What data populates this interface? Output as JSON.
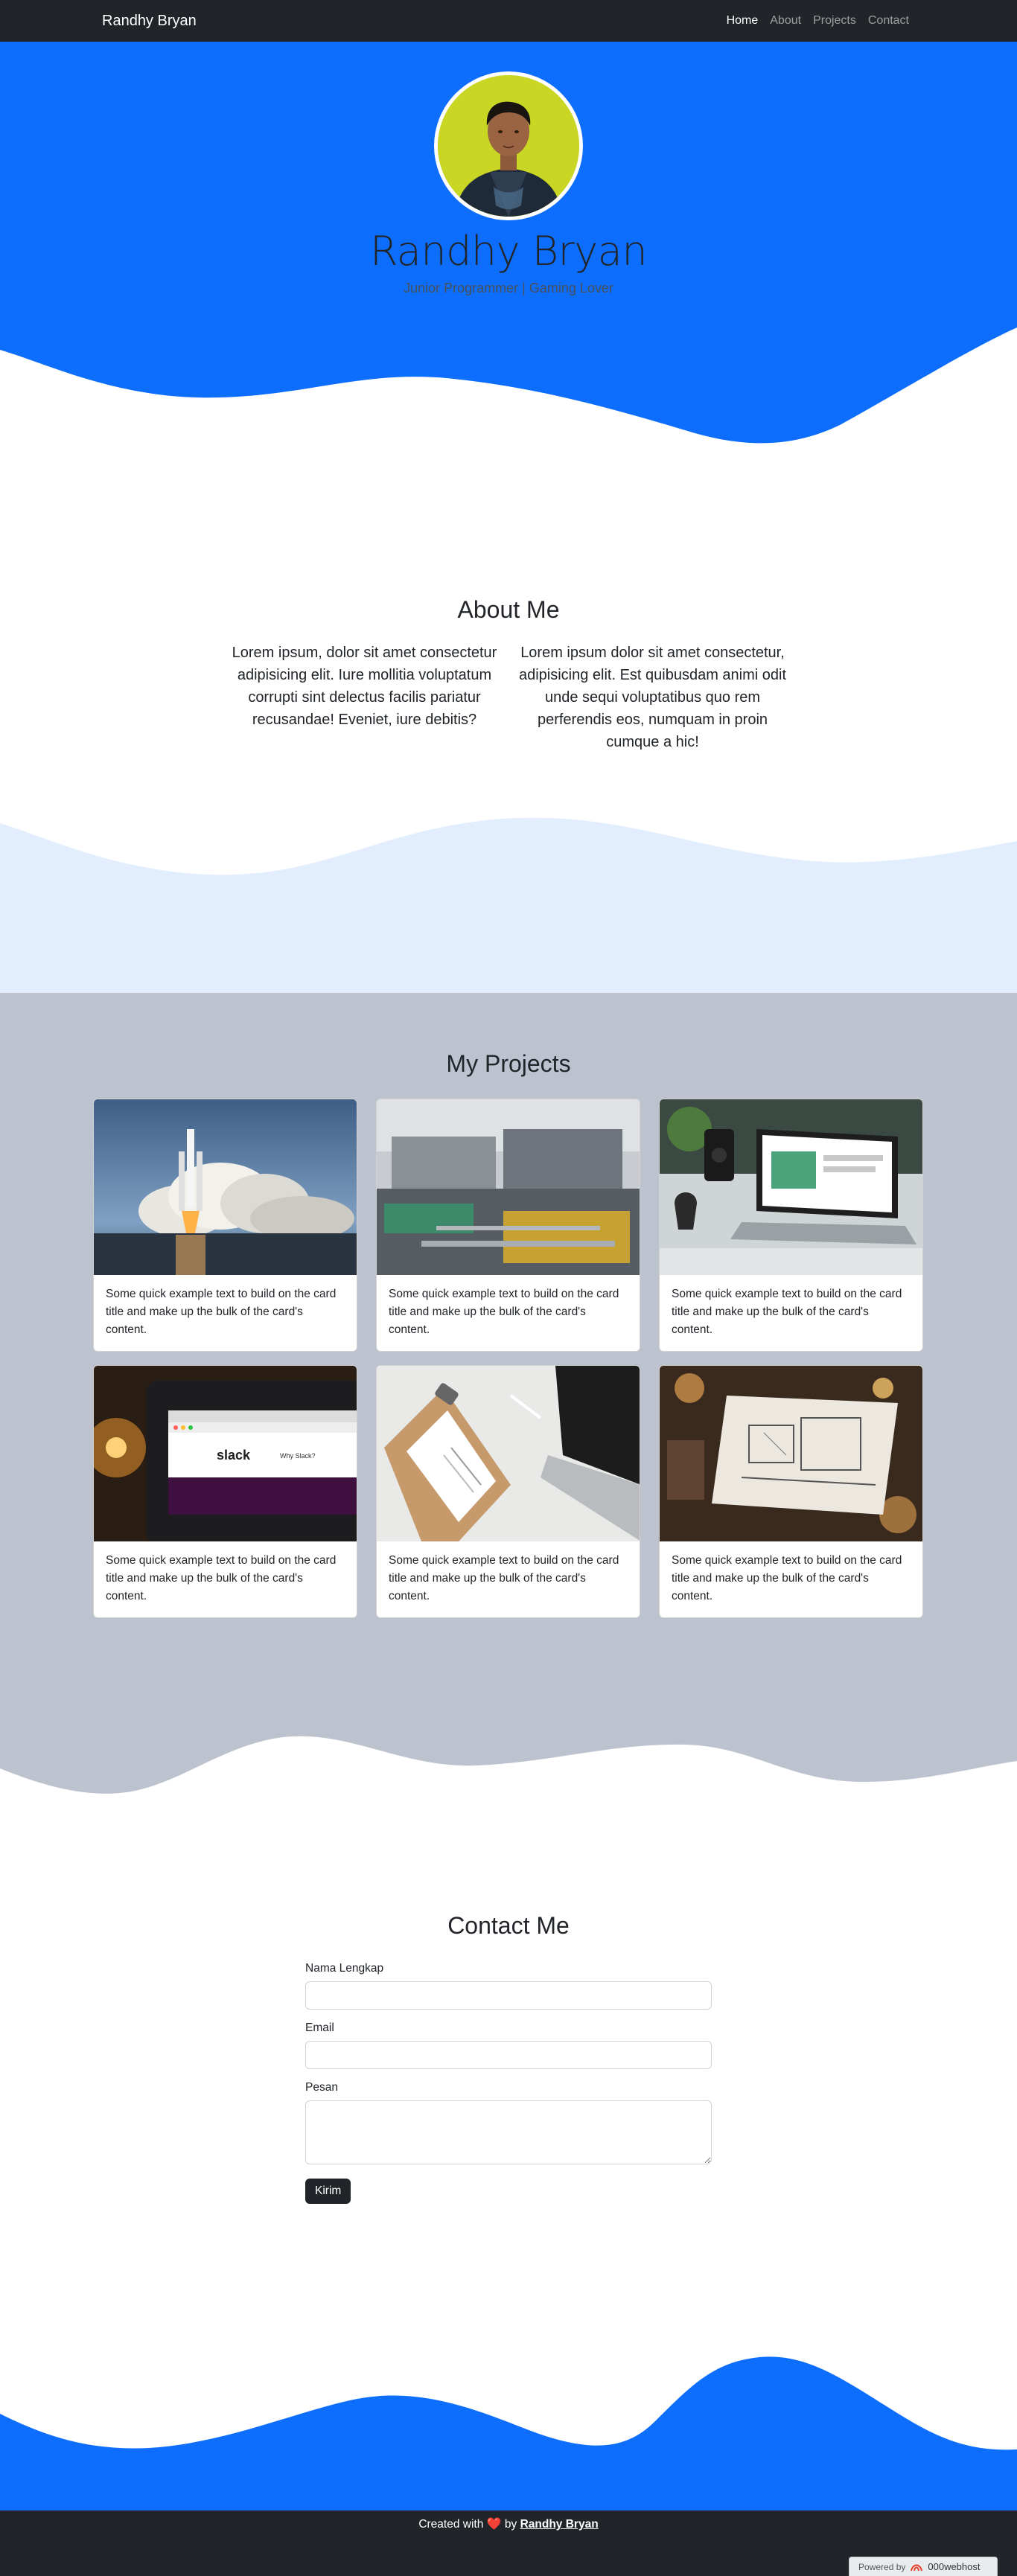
{
  "navbar": {
    "brand": "Randhy Bryan",
    "links": [
      {
        "label": "Home",
        "active": true
      },
      {
        "label": "About",
        "active": false
      },
      {
        "label": "Projects",
        "active": false
      },
      {
        "label": "Contact",
        "active": false
      }
    ]
  },
  "hero": {
    "name": "Randhy Bryan",
    "tagline": "Junior Programmer | Gaming Lover"
  },
  "about": {
    "title": "About Me",
    "col1": "Lorem ipsum, dolor sit amet consectetur adipisicing elit. Iure mollitia voluptatum corrupti sint delectus facilis pariatur recusandae! Eveniet, iure debitis?",
    "col2": "Lorem ipsum dolor sit amet consectetur, adipisicing elit. Est quibusdam animi odit unde sequi voluptatibus quo rem perferendis eos, numquam in proin cumque a hic!"
  },
  "projects": {
    "title": "My Projects",
    "cards": [
      {
        "image": "rocket-launch",
        "text": "Some quick example text to build on the card title and make up the bulk of the card's content."
      },
      {
        "image": "industrial-site",
        "text": "Some quick example text to build on the card title and make up the bulk of the card's content."
      },
      {
        "image": "laptop-desk",
        "text": "Some quick example text to build on the card title and make up the bulk of the card's content."
      },
      {
        "image": "slack-browser",
        "text": "Some quick example text to build on the card title and make up the bulk of the card's content."
      },
      {
        "image": "clipboard-laptop",
        "text": "Some quick example text to build on the card title and make up the bulk of the card's content."
      },
      {
        "image": "blueprint-sketch",
        "text": "Some quick example text to build on the card title and make up the bulk of the card's content."
      }
    ]
  },
  "contact": {
    "title": "Contact Me",
    "name_label": "Nama Lengkap",
    "email_label": "Email",
    "message_label": "Pesan",
    "submit_label": "Kirim"
  },
  "footer": {
    "prefix": "Created with",
    "by": "by",
    "author": "Randhy Bryan",
    "powered_label": "Powered by",
    "powered_brand": "000webhost"
  },
  "colors": {
    "primary": "#0d6efd",
    "dark": "#212529",
    "light_blue": "#e2eefe",
    "gray": "#bcc3ce"
  }
}
